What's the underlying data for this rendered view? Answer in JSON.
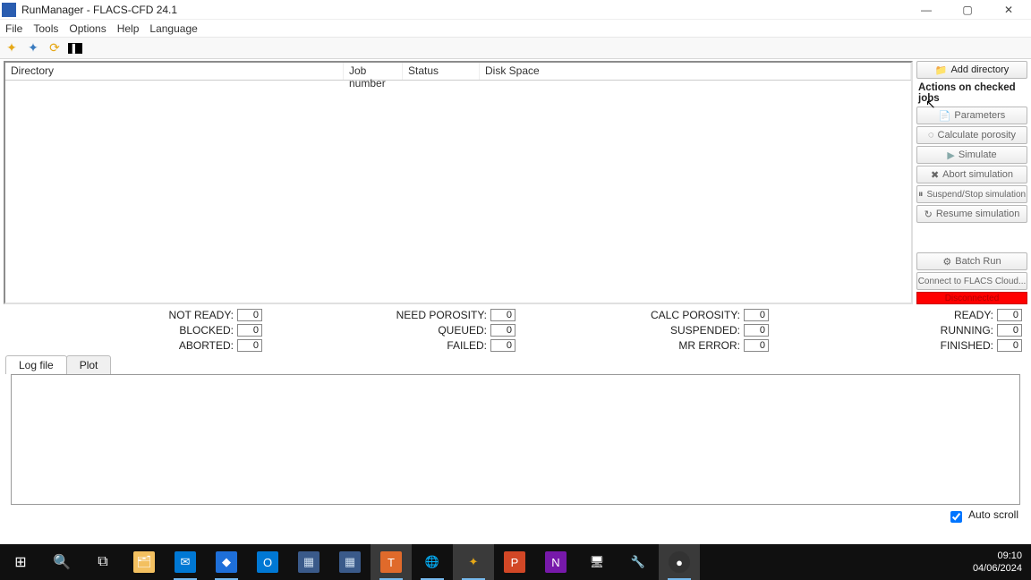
{
  "window": {
    "title": "RunManager - FLACS-CFD 24.1"
  },
  "menu": {
    "file": "File",
    "tools": "Tools",
    "options": "Options",
    "help": "Help",
    "language": "Language"
  },
  "grid": {
    "columns": {
      "directory": "Directory",
      "job_number": "Job number",
      "status": "Status",
      "disk_space": "Disk Space"
    }
  },
  "side": {
    "add_directory": "Add directory",
    "section": "Actions on checked jobs",
    "parameters": "Parameters",
    "calc_porosity": "Calculate porosity",
    "simulate": "Simulate",
    "abort": "Abort simulation",
    "suspend": "Suspend/Stop simulation",
    "resume": "Resume simulation",
    "batch_run": "Batch Run",
    "connect": "Connect to FLACS Cloud...",
    "disconnected": "Disconnected"
  },
  "counters": {
    "not_ready": {
      "label": "NOT READY:",
      "value": "0"
    },
    "need_porosity": {
      "label": "NEED POROSITY:",
      "value": "0"
    },
    "calc_porosity": {
      "label": "CALC POROSITY:",
      "value": "0"
    },
    "ready": {
      "label": "READY:",
      "value": "0"
    },
    "blocked": {
      "label": "BLOCKED:",
      "value": "0"
    },
    "queued": {
      "label": "QUEUED:",
      "value": "0"
    },
    "suspended": {
      "label": "SUSPENDED:",
      "value": "0"
    },
    "running": {
      "label": "RUNNING:",
      "value": "0"
    },
    "aborted": {
      "label": "ABORTED:",
      "value": "0"
    },
    "failed": {
      "label": "FAILED:",
      "value": "0"
    },
    "mr_error": {
      "label": "MR ERROR:",
      "value": "0"
    },
    "finished": {
      "label": "FINISHED:",
      "value": "0"
    }
  },
  "tabs": {
    "log_file": "Log file",
    "plot": "Plot"
  },
  "autoscroll": "Auto scroll",
  "clock": {
    "time": "09:10",
    "date": "04/06/2024"
  },
  "icons": {
    "folder": "📁",
    "play": "▶",
    "stop": "✖",
    "pause": "⏸",
    "reload": "↻",
    "params": "📄",
    "gear": "⚙",
    "porosity": "◌",
    "cloud": "☁"
  }
}
